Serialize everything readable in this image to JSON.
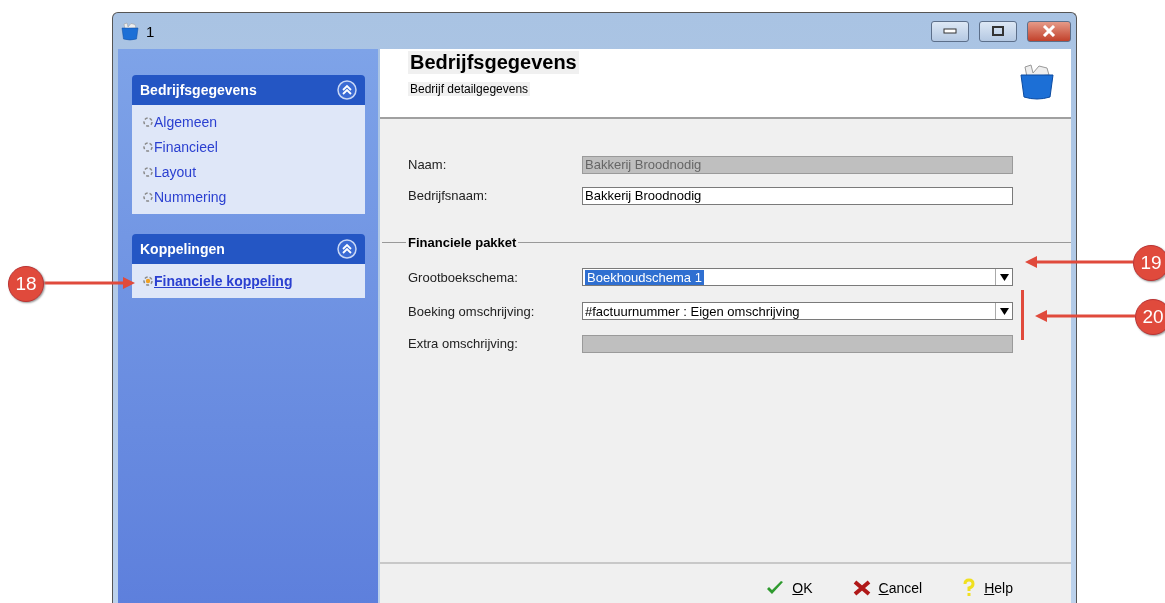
{
  "window": {
    "title": "1"
  },
  "sidebar": {
    "groups": [
      {
        "title": "Bedrijfsgegevens",
        "expanded": true,
        "items": [
          {
            "label": "Algemeen",
            "selected": false
          },
          {
            "label": "Financieel",
            "selected": false
          },
          {
            "label": "Layout",
            "selected": false
          },
          {
            "label": "Nummering",
            "selected": false
          }
        ]
      },
      {
        "title": "Koppelingen",
        "expanded": true,
        "items": [
          {
            "label": "Financiele koppeling",
            "selected": true
          }
        ]
      }
    ]
  },
  "header": {
    "title": "Bedrijfsgegevens",
    "subtitle": "Bedrijf detailgegevens"
  },
  "fields": [
    {
      "label": "Naam:",
      "kind": "text",
      "value": "Bakkerij Broodnodig",
      "disabled": true
    },
    {
      "label": "Bedrijfsnaam:",
      "kind": "text",
      "value": "Bakkerij Broodnodig",
      "disabled": false
    }
  ],
  "section": {
    "title": "Financiele pakket",
    "fields": [
      {
        "label": "Grootboekschema:",
        "kind": "combo",
        "value": "Boekhoudschema 1",
        "disabled": false,
        "highlighted": true
      },
      {
        "label": "Boeking omschrijving:",
        "kind": "combo",
        "value": "#factuurnummer : Eigen omschrijving",
        "disabled": false,
        "highlighted": false
      },
      {
        "label": "Extra omschrijving:",
        "kind": "text",
        "disabled": true
      }
    ]
  },
  "buttons": [
    {
      "label": "OK",
      "kind": "ok"
    },
    {
      "label": "Cancel",
      "kind": "cancel"
    },
    {
      "label": "Help",
      "kind": "help"
    }
  ],
  "annotations": [
    {
      "number": "18",
      "kind": "arrow"
    },
    {
      "number": "19",
      "kind": "arrow"
    },
    {
      "number": "20",
      "kind": "bracket"
    }
  ]
}
